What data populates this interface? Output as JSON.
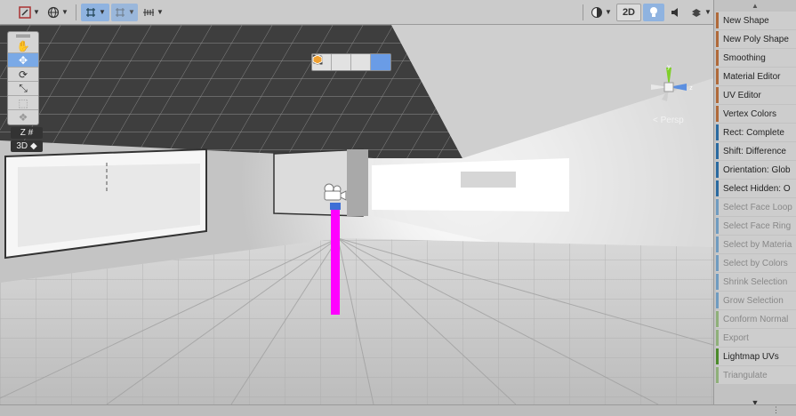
{
  "toolbar": {
    "left_items": [
      {
        "icon": "gizmo-toggle-icon"
      },
      {
        "icon": "globe-icon"
      },
      {
        "icon": "grid-snap-icon",
        "active": true
      },
      {
        "icon": "snap-increment-icon",
        "active": true
      },
      {
        "icon": "ruler-icon"
      }
    ],
    "two_d_label": "2D",
    "right_items": [
      "shading-mode-icon",
      "lighting-icon",
      "audio-icon",
      "effects-icon",
      "visibility-icon",
      "camera-icon",
      "gizmos-icon"
    ]
  },
  "tools": [
    {
      "icon": "hand-tool-icon"
    },
    {
      "icon": "move-tool-icon",
      "active": true
    },
    {
      "icon": "rotate-tool-icon"
    },
    {
      "icon": "scale-tool-icon"
    },
    {
      "icon": "rect-tool-icon",
      "dim": true
    },
    {
      "icon": "transform-tool-icon",
      "dim": true
    }
  ],
  "tool_extras": [
    "Z",
    "3D"
  ],
  "mode_toolbar": [
    "object-mode-icon",
    "vertex-mode-icon",
    "edge-mode-icon",
    "face-mode-icon"
  ],
  "gizmo": {
    "projection_label": "< Persp"
  },
  "panel": {
    "items": [
      {
        "label": "New Shape",
        "color": "#b06a3a",
        "dim": false
      },
      {
        "label": "New Poly Shape",
        "color": "#b06a3a",
        "dim": false
      },
      {
        "label": "Smoothing",
        "color": "#b06a3a",
        "dim": false
      },
      {
        "label": "Material Editor",
        "color": "#b06a3a",
        "dim": false
      },
      {
        "label": "UV Editor",
        "color": "#b06a3a",
        "dim": false
      },
      {
        "label": "Vertex Colors",
        "color": "#b06a3a",
        "dim": false
      },
      {
        "label": "Rect: Complete",
        "color": "#2a6aa0",
        "dim": false
      },
      {
        "label": "Shift: Difference",
        "color": "#2a6aa0",
        "dim": false
      },
      {
        "label": "Orientation: Glob",
        "color": "#2a6aa0",
        "dim": false
      },
      {
        "label": "Select Hidden: O",
        "color": "#2a6aa0",
        "dim": false
      },
      {
        "label": "Select Face Loop",
        "color": "#6f9bc0",
        "dim": true
      },
      {
        "label": "Select Face Ring",
        "color": "#6f9bc0",
        "dim": true
      },
      {
        "label": "Select by Materia",
        "color": "#6f9bc0",
        "dim": true
      },
      {
        "label": "Select by Colors",
        "color": "#6f9bc0",
        "dim": true
      },
      {
        "label": "Shrink Selection",
        "color": "#6f9bc0",
        "dim": true
      },
      {
        "label": "Grow Selection",
        "color": "#6f9bc0",
        "dim": true
      },
      {
        "label": "Conform Normal",
        "color": "#8fb07a",
        "dim": true
      },
      {
        "label": "Export",
        "color": "#8fb07a",
        "dim": true
      },
      {
        "label": "Lightmap UVs",
        "color": "#4a8a2a",
        "dim": false
      },
      {
        "label": "Triangulate",
        "color": "#8fb07a",
        "dim": true
      }
    ]
  }
}
